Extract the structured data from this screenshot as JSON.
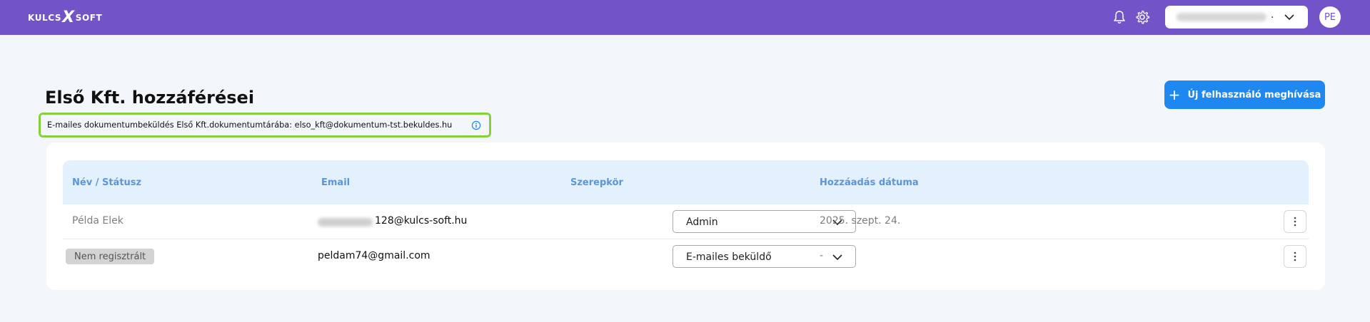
{
  "app": {
    "logo_left": "KULCS",
    "logo_mark": "X",
    "logo_right": "SOFT",
    "user_initials": "PE"
  },
  "header": {
    "title": "Első Kft. hozzáférései",
    "invite_button": "Új felhasználó meghívása",
    "invite_icon": "+",
    "email_note": "E-mailes dokumentumbeküldés Első Kft.dokumentumtárába: elso_kft@dokumentum-tst.bekuldes.hu"
  },
  "table": {
    "columns": [
      "Név / Státusz",
      "Email",
      "Szerepkör",
      "Hozzáadás dátuma"
    ],
    "rows": [
      {
        "name": "Példa Elek",
        "email_visible": "128@kulcs-soft.hu",
        "role": "Admin",
        "date": "2025. szept. 24."
      },
      {
        "status": "Nem regisztrált",
        "email": "peldam74@gmail.com",
        "role": "E-mailes beküldő",
        "date": "-"
      }
    ]
  },
  "colors": {
    "topbar": "#7354c8",
    "primary_button": "#1e88f0",
    "highlight_border": "#86d13a",
    "table_header_bg": "#e3f0fd",
    "table_header_text": "#5c95d8"
  },
  "icons": [
    "bell-icon",
    "gear-icon",
    "chevron-down-icon",
    "info-icon",
    "plus-icon",
    "kebab-menu-icon"
  ]
}
